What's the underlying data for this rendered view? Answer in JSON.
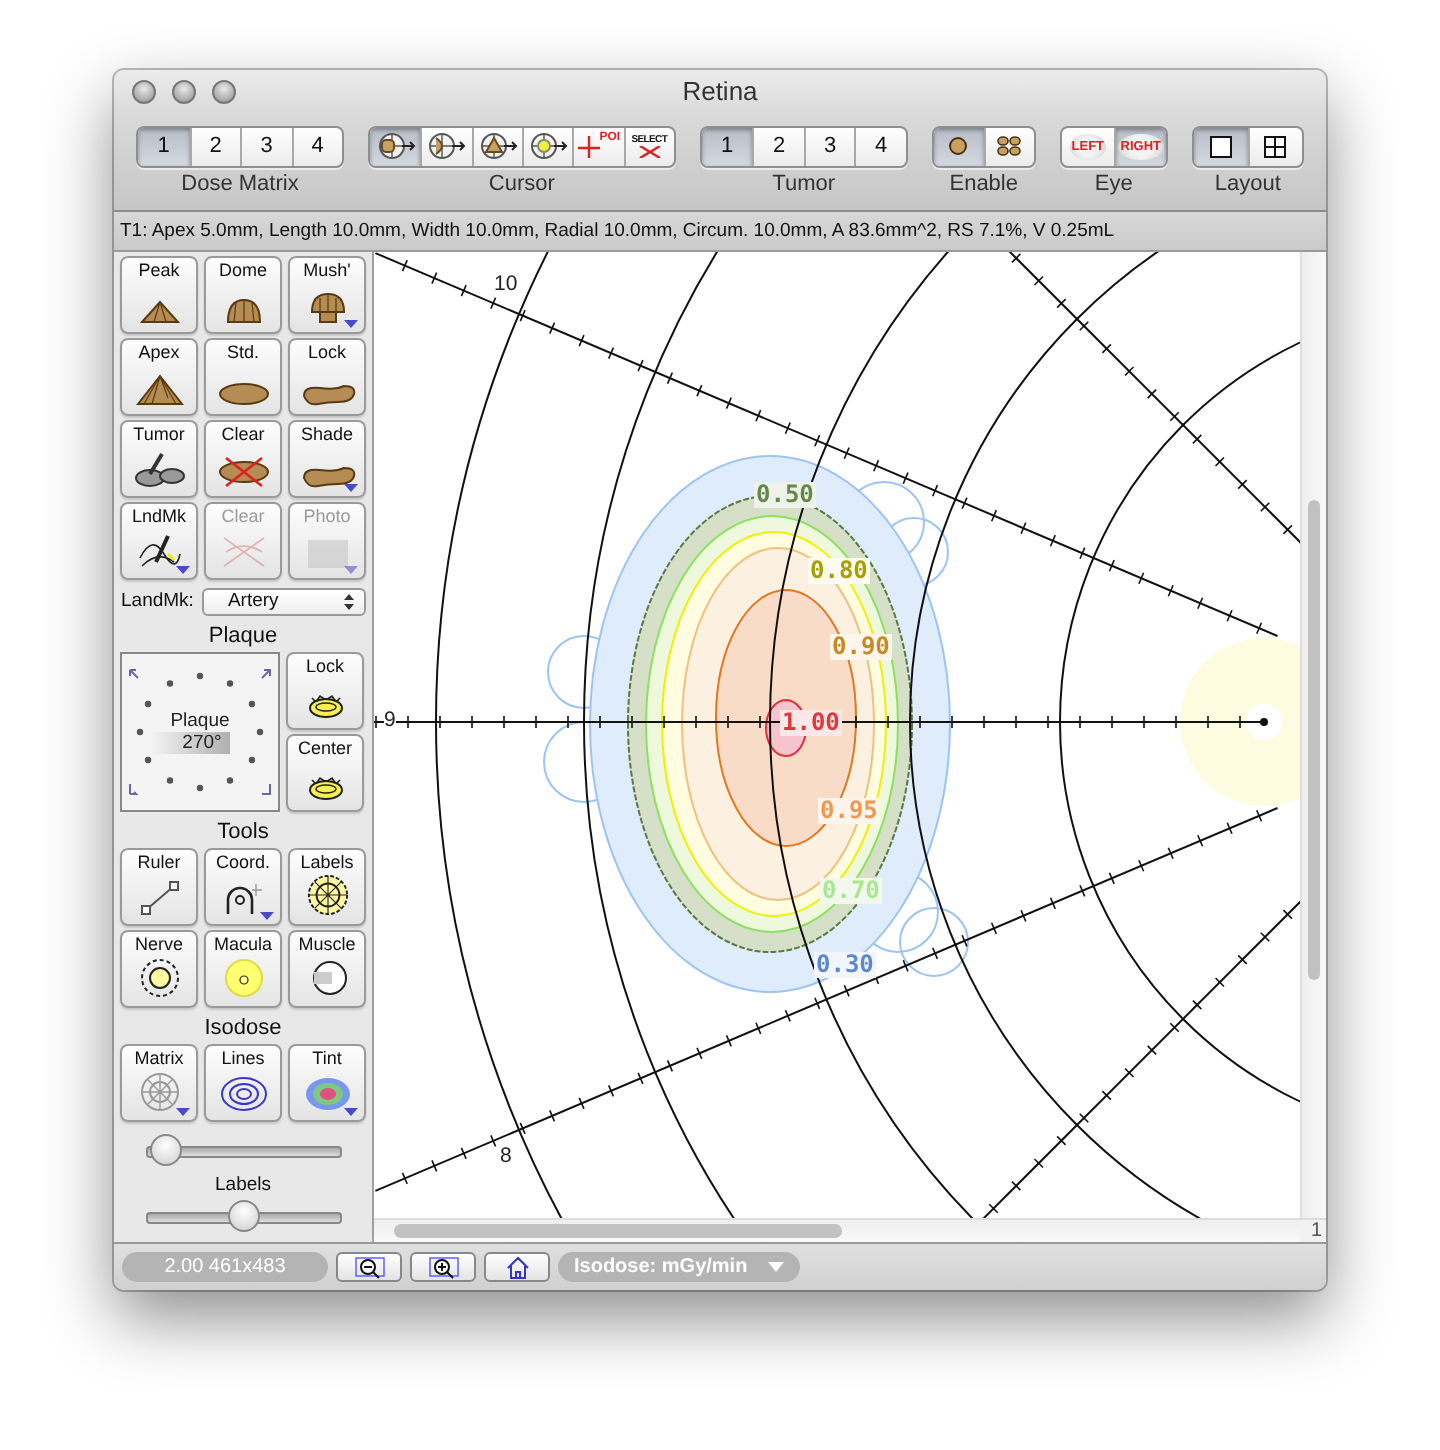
{
  "window": {
    "title": "Retina"
  },
  "toolbar": {
    "groups": [
      {
        "label": "Dose Matrix",
        "kind": "number",
        "items": [
          {
            "text": "1",
            "selected": true
          },
          {
            "text": "2",
            "selected": false
          },
          {
            "text": "3",
            "selected": false
          },
          {
            "text": "4",
            "selected": false
          }
        ]
      },
      {
        "label": "Cursor",
        "kind": "cursor",
        "items": [
          {
            "selected": true
          },
          {
            "selected": false
          },
          {
            "selected": false
          },
          {
            "selected": false
          },
          {
            "text": "POI",
            "selected": false
          },
          {
            "text": "SELECT",
            "selected": false
          }
        ]
      },
      {
        "label": "Tumor",
        "kind": "number",
        "items": [
          {
            "text": "1",
            "selected": true
          },
          {
            "text": "2",
            "selected": false
          },
          {
            "text": "3",
            "selected": false
          },
          {
            "text": "4",
            "selected": false
          }
        ]
      },
      {
        "label": "Enable",
        "kind": "enable",
        "items": [
          {
            "selected": true
          },
          {
            "selected": false
          }
        ]
      },
      {
        "label": "Eye",
        "kind": "eye",
        "items": [
          {
            "text": "LEFT",
            "selected": false
          },
          {
            "text": "RIGHT",
            "selected": true
          }
        ]
      },
      {
        "label": "Layout",
        "kind": "layout",
        "items": [
          {
            "selected": true
          },
          {
            "selected": false
          }
        ]
      }
    ]
  },
  "info_bar": "T1: Apex 5.0mm, Length 10.0mm, Width 10.0mm, Radial 10.0mm, Circum. 10.0mm, A 83.6mm^2, RS 7.1%, V 0.25mL",
  "sidebar": {
    "plaque_tools": [
      {
        "label": "Peak",
        "disabled": false,
        "menu": false
      },
      {
        "label": "Dome",
        "disabled": false,
        "menu": false
      },
      {
        "label": "Mush'",
        "disabled": false,
        "menu": true
      },
      {
        "label": "Apex",
        "disabled": false,
        "menu": false
      },
      {
        "label": "Std.",
        "disabled": false,
        "menu": false
      },
      {
        "label": "Lock",
        "disabled": false,
        "menu": false
      },
      {
        "label": "Tumor",
        "disabled": false,
        "menu": false
      },
      {
        "label": "Clear",
        "disabled": false,
        "menu": false
      },
      {
        "label": "Shade",
        "disabled": false,
        "menu": true
      },
      {
        "label": "LndMk",
        "disabled": false,
        "menu": true
      },
      {
        "label": "Clear",
        "disabled": true,
        "menu": false
      },
      {
        "label": "Photo",
        "disabled": true,
        "menu": true
      }
    ],
    "landmark": {
      "label": "LandMk:",
      "value": "Artery"
    },
    "plaque": {
      "title": "Plaque",
      "dial_title": "Plaque",
      "angle": "270°",
      "buttons": [
        {
          "label": "Lock"
        },
        {
          "label": "Center"
        }
      ]
    },
    "tools": {
      "title": "Tools",
      "items": [
        {
          "label": "Ruler",
          "menu": false
        },
        {
          "label": "Coord.",
          "menu": true
        },
        {
          "label": "Labels",
          "menu": false
        },
        {
          "label": "Nerve",
          "menu": false
        },
        {
          "label": "Macula",
          "menu": false
        },
        {
          "label": "Muscle",
          "menu": false
        }
      ]
    },
    "isodose": {
      "title": "Isodose",
      "items": [
        {
          "label": "Matrix",
          "menu": true
        },
        {
          "label": "Lines",
          "menu": false
        },
        {
          "label": "Tint",
          "menu": true
        }
      ]
    },
    "isodose_slider": {
      "level": 0.03
    },
    "labels_slider": {
      "label": "Labels",
      "level": 0.5
    }
  },
  "dose_view": {
    "grid_labels": [
      "10",
      "9",
      "8"
    ],
    "isodose_labels": [
      {
        "text": "0.50",
        "color": "#5f8a48"
      },
      {
        "text": "0.80",
        "color": "#a8a000"
      },
      {
        "text": "0.90",
        "color": "#c88a20"
      },
      {
        "text": "1.00",
        "color": "#e03838"
      },
      {
        "text": "0.95",
        "color": "#ec9a50"
      },
      {
        "text": "0.70",
        "color": "#a8e890"
      },
      {
        "text": "0.30",
        "color": "#5a88d0"
      }
    ],
    "page_indicator": "1"
  },
  "status_bar": {
    "readout": "2.00 461x483",
    "isodose_menu": "Isodose: mGy/min"
  }
}
